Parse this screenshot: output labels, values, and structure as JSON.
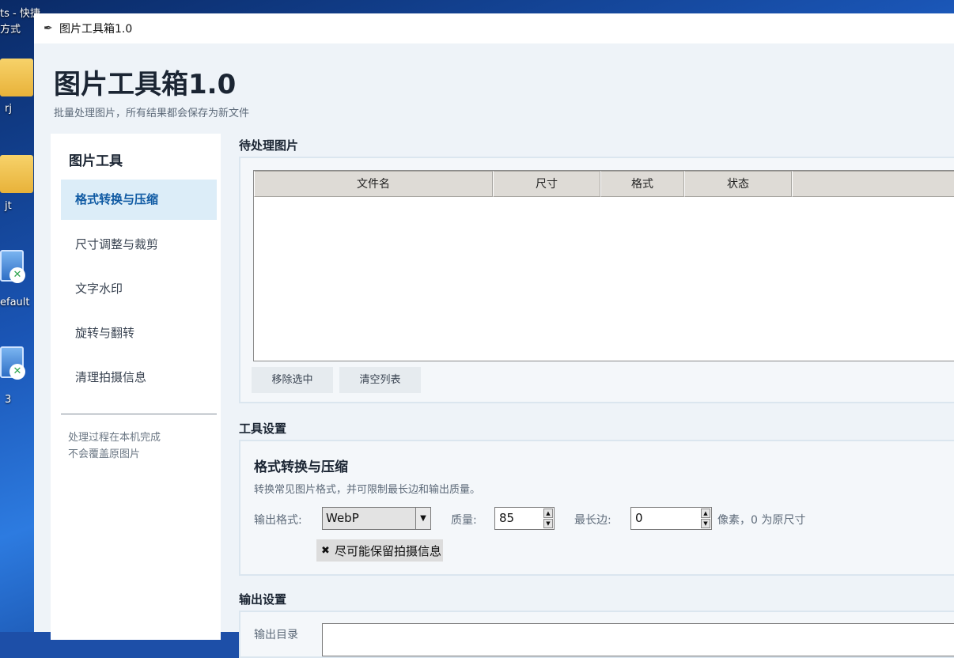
{
  "desktop": {
    "icon_top_label_line1": "ts - 快捷",
    "icon_top_label_line2": "方式",
    "icons": [
      {
        "label": "rj"
      },
      {
        "label": "jt"
      },
      {
        "label": "efault"
      },
      {
        "label": "3"
      }
    ]
  },
  "window": {
    "title": "图片工具箱1.0",
    "icon": "feather-icon"
  },
  "header": {
    "title": "图片工具箱1.0",
    "subtitle": "批量处理图片，所有结果都会保存为新文件"
  },
  "sidebar": {
    "title": "图片工具",
    "items": [
      {
        "label": "格式转换与压缩",
        "active": true
      },
      {
        "label": "尺寸调整与裁剪",
        "active": false
      },
      {
        "label": "文字水印",
        "active": false
      },
      {
        "label": "旋转与翻转",
        "active": false
      },
      {
        "label": "清理拍摄信息",
        "active": false
      }
    ],
    "note_line1": "处理过程在本机完成",
    "note_line2": "不会覆盖原图片"
  },
  "pending": {
    "section_label": "待处理图片",
    "columns": [
      "文件名",
      "尺寸",
      "格式",
      "状态",
      ""
    ],
    "rows": [],
    "remove_button": "移除选中",
    "clear_button": "清空列表"
  },
  "tool_settings": {
    "section_label": "工具设置",
    "title": "格式转换与压缩",
    "description": "转换常见图片格式，并可限制最长边和输出质量。",
    "format_label": "输出格式:",
    "format_value": "WebP",
    "quality_label": "质量:",
    "quality_value": "85",
    "max_edge_label": "最长边:",
    "max_edge_value": "0",
    "max_edge_suffix": "像素，0 为原尺寸",
    "keep_exif_label": "尽可能保留拍摄信息",
    "keep_exif_checked": true,
    "checkbox_mark": "✖"
  },
  "output_settings": {
    "section_label": "输出设置",
    "dir_label": "输出目录",
    "dir_value": ""
  },
  "colors": {
    "accent": "#0f5aa3",
    "active_bg": "#dcedf8",
    "window_bg": "#eef3f8"
  }
}
